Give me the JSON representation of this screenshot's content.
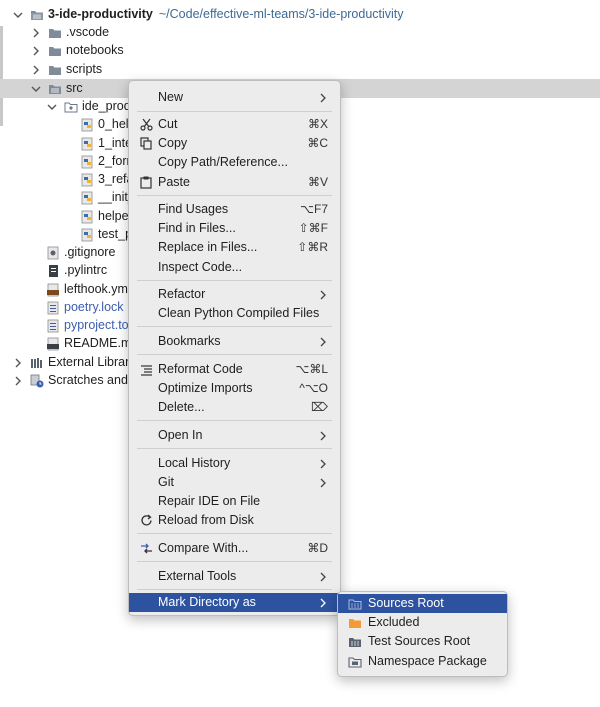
{
  "project": {
    "root_name": "3-ide-productivity",
    "root_path": "~/Code/effective-ml-teams/3-ide-productivity",
    "items": [
      {
        "label": ".vscode"
      },
      {
        "label": "notebooks"
      },
      {
        "label": "scripts"
      },
      {
        "label": "src"
      },
      {
        "label": "ide_produc"
      },
      {
        "label": "0_hel"
      },
      {
        "label": "1_inte"
      },
      {
        "label": "2_forr"
      },
      {
        "label": "3_refa"
      },
      {
        "label": "__init_"
      },
      {
        "label": "helper"
      },
      {
        "label": "test_p"
      },
      {
        "label": ".gitignore"
      },
      {
        "label": ".pylintrc"
      },
      {
        "label": "lefthook.ym"
      },
      {
        "label": "poetry.lock"
      },
      {
        "label": "pyproject.to"
      },
      {
        "label": "README.mc"
      },
      {
        "label": "External Librari"
      },
      {
        "label": "Scratches and"
      }
    ]
  },
  "context_menu": {
    "new": "New",
    "cut": "Cut",
    "cut_sc": "⌘X",
    "copy": "Copy",
    "copy_sc": "⌘C",
    "copy_path": "Copy Path/Reference...",
    "paste": "Paste",
    "paste_sc": "⌘V",
    "find_usages": "Find Usages",
    "find_usages_sc": "⌥F7",
    "find_in_files": "Find in Files...",
    "find_in_files_sc": "⇧⌘F",
    "replace_in_files": "Replace in Files...",
    "replace_in_files_sc": "⇧⌘R",
    "inspect_code": "Inspect Code...",
    "refactor": "Refactor",
    "clean_python": "Clean Python Compiled Files",
    "bookmarks": "Bookmarks",
    "reformat": "Reformat Code",
    "reformat_sc": "⌥⌘L",
    "optimize_imports": "Optimize Imports",
    "optimize_imports_sc": "^⌥O",
    "delete": "Delete...",
    "delete_sc": "⌦",
    "open_in": "Open In",
    "local_history": "Local History",
    "git": "Git",
    "repair_ide": "Repair IDE on File",
    "reload": "Reload from Disk",
    "compare_with": "Compare With...",
    "compare_with_sc": "⌘D",
    "external_tools": "External Tools",
    "mark_directory": "Mark Directory as"
  },
  "submenu": {
    "sources_root": "Sources Root",
    "excluded": "Excluded",
    "test_sources_root": "Test Sources Root",
    "namespace_package": "Namespace Package"
  },
  "colors": {
    "selection": "#2d53a0",
    "tree_selection": "#d4d4d4",
    "folder": "#7f8b99",
    "excluded_folder": "#f39c35",
    "path": "#3d6a94"
  }
}
